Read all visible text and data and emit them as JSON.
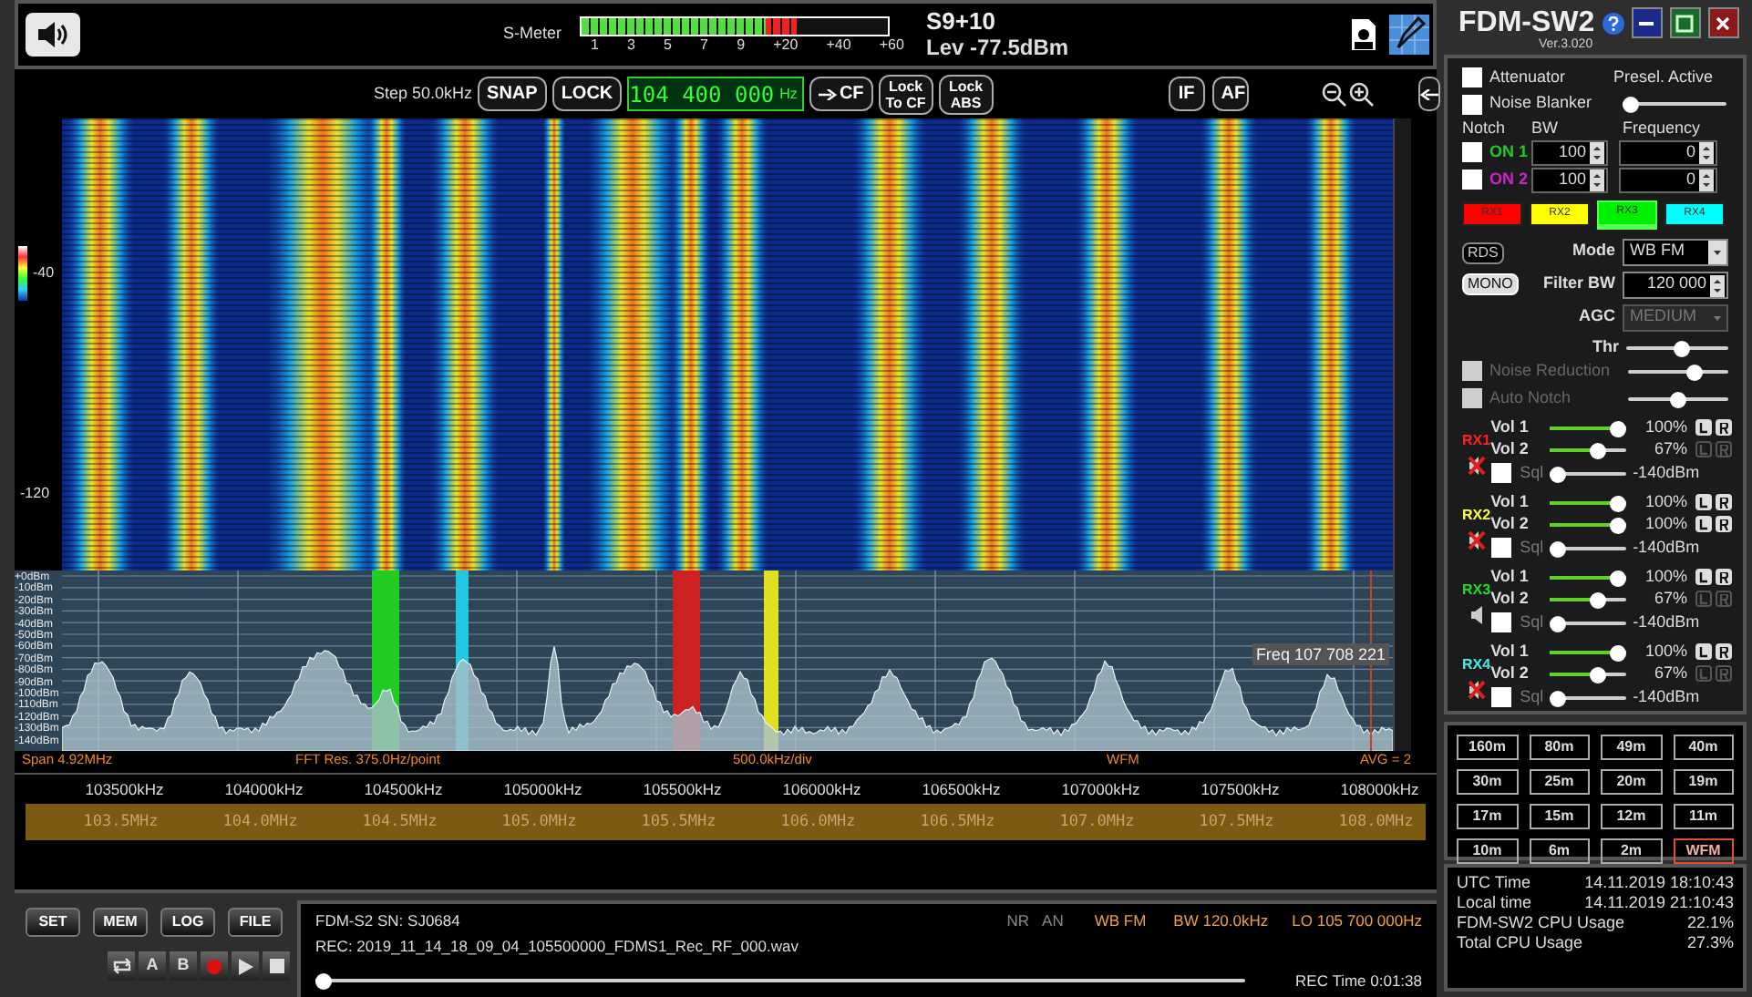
{
  "top_bar": {
    "smeter": {
      "label": "S-Meter",
      "level": 0.7,
      "scale": [
        "1",
        "3",
        "5",
        "7",
        "9",
        "+20",
        "+40",
        "+60"
      ]
    },
    "s_reading": "S9+10",
    "level_reading": "Lev -77.5dBm"
  },
  "toolbar": {
    "step": "Step 50.0kHz",
    "left_buttons": [
      "SNAP",
      "LOCK"
    ],
    "frequency": "104 400 000",
    "frequency_unit": "Hz",
    "right_buttons": [
      {
        "label": "CF",
        "kind": "arrow"
      },
      {
        "label": "Lock To CF",
        "kind": "text"
      },
      {
        "label": "Lock ABS",
        "kind": "text"
      }
    ],
    "view_buttons": [
      "IF",
      "AF"
    ]
  },
  "waterfall": {
    "scale_labels": [
      "-40",
      "-120"
    ]
  },
  "spectrum": {
    "db_labels": [
      "+0dBm",
      "-10dBm",
      "-20dBm",
      "-30dBm",
      "-40dBm",
      "-50dBm",
      "-60dBm",
      "-70dBm",
      "-80dBm",
      "-90dBm",
      "-100dBm",
      "-110dBm",
      "-120dBm",
      "-130dBm",
      "-140dBm"
    ],
    "freq_readout": "Freq 107 708 221",
    "markers": [
      {
        "color": "#22cc22"
      },
      {
        "color": "#22c8e0"
      },
      {
        "color": "#cc2222"
      },
      {
        "color": "#e0e020"
      }
    ]
  },
  "info_row": {
    "span": "Span 4.92MHz",
    "fft": "FFT Res. 375.0Hz/point",
    "div": "500.0kHz/div",
    "mode": "WFM",
    "avg": "AVG = 2"
  },
  "freq_scale": [
    "103500kHz",
    "104000kHz",
    "104500kHz",
    "105000kHz",
    "105500kHz",
    "106000kHz",
    "106500kHz",
    "107000kHz",
    "107500kHz",
    "108000kHz"
  ],
  "band_scale": [
    "103.5MHz",
    "104.0MHz",
    "104.5MHz",
    "105.0MHz",
    "105.5MHz",
    "106.0MHz",
    "106.5MHz",
    "107.0MHz",
    "107.5MHz",
    "108.0MHz"
  ],
  "bottom": {
    "buttons": [
      "SET",
      "MEM",
      "LOG",
      "FILE"
    ],
    "transport": [
      {
        "kind": "loop"
      },
      {
        "kind": "text",
        "label": "A"
      },
      {
        "kind": "text",
        "label": "B"
      },
      {
        "kind": "record"
      },
      {
        "kind": "play"
      },
      {
        "kind": "stop"
      }
    ],
    "device": "FDM-S2 SN: SJ0684",
    "rec_file": "REC: 2019_11_14_18_09_04_105500000_FDMS1_Rec_RF_000.wav",
    "flags": [
      {
        "label": "NR",
        "on": false
      },
      {
        "label": "AN",
        "on": false
      }
    ],
    "mode": "WB FM",
    "bw": "BW 120.0kHz",
    "lo": "LO 105 700 000Hz",
    "progress": {
      "level": 0
    },
    "rec_time": "REC Time 0:01:38"
  },
  "panel": {
    "title": "FDM-SW2",
    "version": "Ver.3.020",
    "attenuator": {
      "label": "Attenuator",
      "checked": false
    },
    "presel": {
      "label": "Presel. Active"
    },
    "noise_blanker": {
      "label": "Noise Blanker",
      "checked": false,
      "level": 0
    },
    "notch": {
      "headers": [
        "Notch",
        "BW",
        "Frequency"
      ],
      "rows": [
        {
          "label": "ON 1",
          "checked": false,
          "color": "#22cc22",
          "bw": "100",
          "frequency": "0"
        },
        {
          "label": "ON 2",
          "checked": false,
          "color": "#cc22cc",
          "bw": "100",
          "frequency": "0"
        }
      ]
    },
    "rx_tabs": [
      {
        "label": "RX1",
        "color": "#ff0000",
        "selected": false
      },
      {
        "label": "RX2",
        "color": "#ffff00",
        "selected": false
      },
      {
        "label": "RX3",
        "color": "#00ee00",
        "selected": true
      },
      {
        "label": "RX4",
        "color": "#00ffff",
        "selected": false
      }
    ],
    "rds": {
      "label": "RDS",
      "on": false
    },
    "mono": {
      "label": "MONO",
      "on": true
    },
    "mode": {
      "label": "Mode",
      "value": "WB FM"
    },
    "filter_bw": {
      "label": "Filter BW",
      "value": "120 000"
    },
    "agc": {
      "label": "AGC",
      "value": "MEDIUM",
      "disabled": true
    },
    "thr": {
      "label": "Thr",
      "level": 0.55
    },
    "noise_reduction": {
      "label": "Noise Reduction",
      "checked": false,
      "disabled": true,
      "level": 0.7
    },
    "auto_notch": {
      "label": "Auto Notch",
      "checked": false,
      "disabled": true,
      "level": 0.5
    },
    "receivers": [
      {
        "label": "RX1",
        "color": "#ff2222",
        "muted": true,
        "vol1": {
          "label": "Vol 1",
          "level": 1,
          "reading": "100%",
          "lr_enabled": true
        },
        "vol2": {
          "label": "Vol 2",
          "level": 0.67,
          "reading": "67%",
          "lr_enabled": false
        },
        "sql": {
          "label": "Sql",
          "checked": false,
          "level": 0,
          "reading": "-140dBm"
        }
      },
      {
        "label": "RX2",
        "color": "#ffff44",
        "muted": true,
        "vol1": {
          "label": "Vol 1",
          "level": 1,
          "reading": "100%",
          "lr_enabled": true
        },
        "vol2": {
          "label": "Vol 2",
          "level": 1,
          "reading": "100%",
          "lr_enabled": true
        },
        "sql": {
          "label": "Sql",
          "checked": false,
          "level": 0,
          "reading": "-140dBm"
        }
      },
      {
        "label": "RX3",
        "color": "#22dd22",
        "muted": false,
        "vol1": {
          "label": "Vol 1",
          "level": 1,
          "reading": "100%",
          "lr_enabled": true
        },
        "vol2": {
          "label": "Vol 2",
          "level": 0.67,
          "reading": "67%",
          "lr_enabled": false
        },
        "sql": {
          "label": "Sql",
          "checked": false,
          "level": 0,
          "reading": "-140dBm"
        }
      },
      {
        "label": "RX4",
        "color": "#44eeee",
        "muted": true,
        "vol1": {
          "label": "Vol 1",
          "level": 1,
          "reading": "100%",
          "lr_enabled": true
        },
        "vol2": {
          "label": "Vol 2",
          "level": 0.67,
          "reading": "67%",
          "lr_enabled": false
        },
        "sql": {
          "label": "Sql",
          "checked": false,
          "level": 0,
          "reading": "-140dBm"
        }
      }
    ],
    "bands": [
      {
        "label": "160m",
        "selected": false
      },
      {
        "label": "80m",
        "selected": false
      },
      {
        "label": "49m",
        "selected": false
      },
      {
        "label": "40m",
        "selected": false
      },
      {
        "label": "30m",
        "selected": false
      },
      {
        "label": "25m",
        "selected": false
      },
      {
        "label": "20m",
        "selected": false
      },
      {
        "label": "19m",
        "selected": false
      },
      {
        "label": "17m",
        "selected": false
      },
      {
        "label": "15m",
        "selected": false
      },
      {
        "label": "12m",
        "selected": false
      },
      {
        "label": "11m",
        "selected": false
      },
      {
        "label": "10m",
        "selected": false
      },
      {
        "label": "6m",
        "selected": false
      },
      {
        "label": "2m",
        "selected": false
      },
      {
        "label": "WFM",
        "selected": true
      }
    ],
    "status": [
      {
        "label": "UTC Time",
        "value": "14.11.2019 18:10:43"
      },
      {
        "label": "Local time",
        "value": "14.11.2019 21:10:43"
      },
      {
        "label": "FDM-SW2 CPU Usage",
        "value": "22.1%"
      },
      {
        "label": "Total CPU Usage",
        "value": "27.3%"
      }
    ]
  }
}
